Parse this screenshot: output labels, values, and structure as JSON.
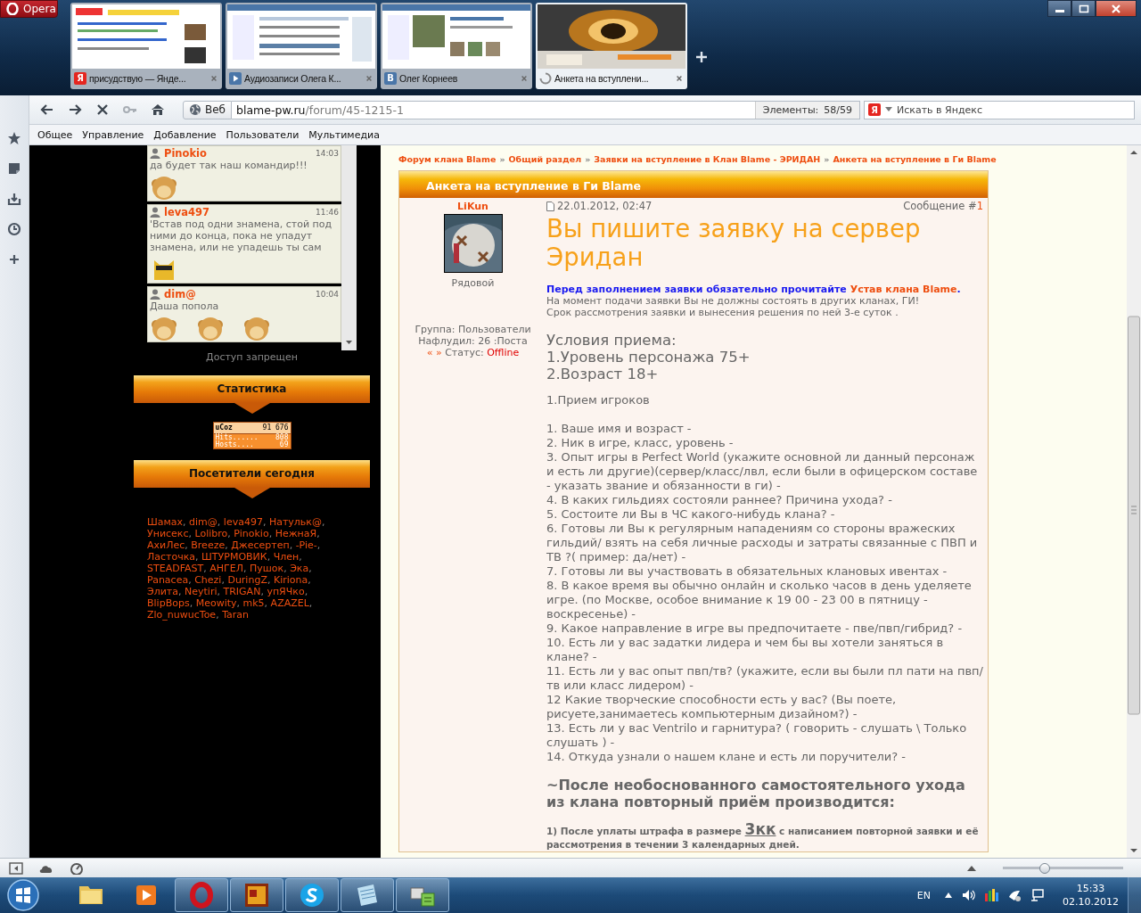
{
  "browser": {
    "menu_button": "Opera",
    "tabs": [
      {
        "title": "присудствую — Янде...",
        "selected": false,
        "favicon": {
          "kind": "letter",
          "text": "Я",
          "color": "#e52620"
        }
      },
      {
        "title": "Аудиозаписи Олега К...",
        "selected": false,
        "favicon": {
          "kind": "play",
          "color": "#4a76a8"
        }
      },
      {
        "title": "Олег Корнеев",
        "selected": false,
        "favicon": {
          "kind": "letter",
          "text": "В",
          "color": "#4a76a8"
        }
      },
      {
        "title": "Анкета на вступлени...",
        "selected": true,
        "favicon": {
          "kind": "loading",
          "color": "#8a8a8a"
        }
      }
    ],
    "address": {
      "scope_button": "Веб",
      "host": "blame-pw.ru",
      "path": "/forum/45-1215-1",
      "elements_label": "Элементы:",
      "elements_count": "58/59"
    },
    "search": {
      "engine_letter": "Я",
      "placeholder": "Искать в Яндекс"
    },
    "bookmarks": [
      "Общее",
      "Управление",
      "Добавление",
      "Пользователи",
      "Мультимедиа"
    ],
    "zoom_slider": {
      "level": 0.3
    }
  },
  "chat": {
    "messages": [
      {
        "user": "Pinokio",
        "time": "14:03",
        "text": "да будет так наш командир!!!",
        "emoticons": [
          {
            "kind": "monkey"
          }
        ]
      },
      {
        "user": "leva497",
        "time": "11:46",
        "text": "'Встав под одни знамена, стой под ними до конца, пока не упадут знамена, или не упадешь ты сам",
        "emoticons": [
          {
            "kind": "cat"
          }
        ]
      },
      {
        "user": "dim@",
        "time": "10:04",
        "text": "Даша попола",
        "emoticons": [
          {
            "kind": "monkey"
          },
          {
            "kind": "monkey"
          },
          {
            "kind": "monkey"
          }
        ]
      }
    ],
    "footer": "Доступ запрещен"
  },
  "statistics": {
    "title": "Статистика",
    "counter": {
      "brand": "uCoz",
      "total": "91 676",
      "rows": [
        {
          "label": "Hits......",
          "value": "808"
        },
        {
          "label": "Hosts....",
          "value": "69"
        }
      ]
    }
  },
  "visitors": {
    "title": "Посетители сегодня",
    "separator": ", ",
    "names": [
      "Шамах",
      "dim@",
      "leva497",
      "Натульк@",
      "Унисекс",
      "Lolibro",
      "Pinokio",
      "НежнаЯ",
      "АхиЛес",
      "Breeze",
      "Джесертеп",
      "-Pie-",
      "Ласточка",
      "ШТУРМОВИК",
      "Член",
      "STEADFAST",
      "АНГЕЛ",
      "Пушок",
      "Эка",
      "Panacea",
      "Chezi",
      "DuringZ",
      "Kiriona",
      "Элита",
      "Neytiri",
      "TRIGAN",
      "упЯЧко",
      "BlipBops",
      "Meowity",
      "mk5",
      "AZAZEL",
      "Zlo_nuwucToe",
      "Taran"
    ]
  },
  "breadcrumb": {
    "separator": "»",
    "items": [
      "Форум клана Blame",
      "Общий раздел",
      "Заявки на вступление в Клан Blame - ЭРИДАН",
      "Анкета на вступление в Ги Blame"
    ]
  },
  "post": {
    "topic": "Анкета на вступление в Ги Blame",
    "author": {
      "name": "LiKun",
      "rank": "Рядовой",
      "group": "Группа: Пользователи",
      "posts": "Нафлудил: 26 :Поста",
      "arrows": "« »",
      "status_label": "Статус:",
      "status": "Offline"
    },
    "date": "22.01.2012, 02:47",
    "message_label": "Сообщение #",
    "message_number": "1",
    "title": "Вы пишите заявку на сервер Эридан",
    "notice": {
      "text": "Перед заполнением заявки обязательно прочитайте ",
      "link": "Устав клана Blame",
      "end": "."
    },
    "notes": [
      "На момент подачи заявки Вы не должны состоять в других кланах, ГИ!",
      "Срок рассмотрения заявки и вынесения решения по ней 3-е суток ."
    ],
    "conditions": [
      "Условия приема:",
      "1.Уровень персонажа 75+",
      "2.Возраст 18+"
    ],
    "intake": "1.Прием игроков",
    "questions": [
      "1. Ваше имя и возраст -",
      "2. Ник в игре, класс, уровень -",
      "3. Опыт игры в Perfect World (укажите основной ли данный персонаж и есть ли другие)(сервер/класс/лвл, если были в офицерском составе - указать звание и обязанности в ги) -",
      "4. В каких гильдиях состояли раннее? Причина ухода? -",
      "5. Состоите ли Вы в ЧС какого-нибудь клана? -",
      "6. Готовы ли Вы к регулярным нападениям со стороны вражеских гильдий/ взять на себя личные расходы и затраты связанные с ПВП и ТВ ?( пример: да/нет) -",
      "7. Готовы ли вы участвовать в обязательных клановых ивентах -",
      "8. В какое время вы обычно онлайн и сколько часов в день уделяете игре. (по Москве, особое внимание к 19 00 - 23 00 в пятницу - воскресенье) -",
      "9. Какое направление в игре вы предпочитаете - пве/пвп/гибрид? -",
      "10. Есть ли у вас задатки лидера и чем бы вы хотели заняться в клане? -",
      "11. Есть ли у вас опыт пвп/тв? (укажите, если вы были пл пати на пвп/тв или класс лидером) -",
      "12 Какие творческие способности есть у вас? (Вы поете, рисуете,занимаетесь компьютерным дизайном?) -",
      "13. Есть ли у вас Ventrilo и гарнитура? ( говорить - слушать \\ Только слушать ) -",
      "14. Откуда узнали о нашем клане и есть ли поручители? -"
    ],
    "rejoin_heading": "~После необоснованного самостоятельного ухода из клана повторный приём производится:",
    "penalty": {
      "before": "1) После уплаты штрафа в размере ",
      "amount": "3кк",
      "after": " с написанием повторной заявки и её рассмотрения в течении 3 календарных дней."
    }
  },
  "taskbar": {
    "apps": [
      {
        "kind": "folder",
        "running": false
      },
      {
        "kind": "media",
        "running": false
      },
      {
        "kind": "opera",
        "running": true
      },
      {
        "kind": "game",
        "running": true
      },
      {
        "kind": "skype",
        "running": true
      },
      {
        "kind": "notepad",
        "running": true
      },
      {
        "kind": "network",
        "running": true
      }
    ],
    "language": "EN",
    "time": "15:33",
    "date": "02.10.2012"
  }
}
